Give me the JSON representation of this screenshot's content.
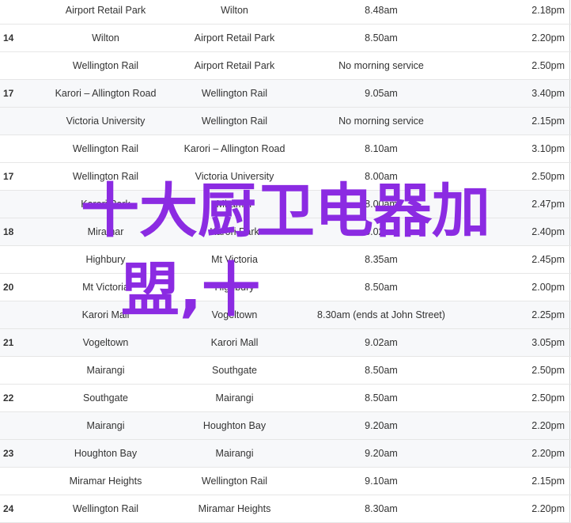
{
  "rows": [
    {
      "route": "",
      "from": "Airport Retail Park",
      "to": "Wilton",
      "depart": "8.48am",
      "arrive": "2.18pm",
      "shade": false
    },
    {
      "route": "14",
      "from": "Wilton",
      "to": "Airport Retail Park",
      "depart": "8.50am",
      "arrive": "2.20pm",
      "shade": false
    },
    {
      "route": "",
      "from": "Wellington Rail",
      "to": "Airport Retail Park",
      "depart": "No morning service",
      "arrive": "2.50pm",
      "shade": false
    },
    {
      "route": "17",
      "from": "Karori – Allington Road",
      "to": "Wellington Rail",
      "depart": "9.05am",
      "arrive": "3.40pm",
      "shade": true
    },
    {
      "route": "",
      "from": "Victoria University",
      "to": "Wellington Rail",
      "depart": "No morning service",
      "arrive": "2.15pm",
      "shade": true
    },
    {
      "route": "",
      "from": "Wellington Rail",
      "to": "Karori – Allington Road",
      "depart": "8.10am",
      "arrive": "3.10pm",
      "shade": false
    },
    {
      "route": "17",
      "from": "Wellington Rail",
      "to": "Victoria University",
      "depart": "8.00am",
      "arrive": "2.50pm",
      "shade": false
    },
    {
      "route": "",
      "from": "Karori Park",
      "to": "Miramar",
      "depart": "8.00am",
      "arrive": "2.47pm",
      "shade": true
    },
    {
      "route": "18",
      "from": "Miramar",
      "to": "Karori Park",
      "depart": "8.02am",
      "arrive": "2.40pm",
      "shade": true
    },
    {
      "route": "",
      "from": "Highbury",
      "to": "Mt Victoria",
      "depart": "8.35am",
      "arrive": "2.45pm",
      "shade": false
    },
    {
      "route": "20",
      "from": "Mt Victoria",
      "to": "Highbury",
      "depart": "8.50am",
      "arrive": "2.00pm",
      "shade": false
    },
    {
      "route": "",
      "from": "Karori Mall",
      "to": "Vogeltown",
      "depart": "8.30am (ends at John Street)",
      "arrive": "2.25pm",
      "shade": true
    },
    {
      "route": "21",
      "from": "Vogeltown",
      "to": "Karori Mall",
      "depart": "9.02am",
      "arrive": "3.05pm",
      "shade": true
    },
    {
      "route": "",
      "from": "Mairangi",
      "to": "Southgate",
      "depart": "8.50am",
      "arrive": "2.50pm",
      "shade": false
    },
    {
      "route": "22",
      "from": "Southgate",
      "to": "Mairangi",
      "depart": "8.50am",
      "arrive": "2.50pm",
      "shade": false
    },
    {
      "route": "",
      "from": "Mairangi",
      "to": "Houghton Bay",
      "depart": "9.20am",
      "arrive": "2.20pm",
      "shade": true
    },
    {
      "route": "23",
      "from": "Houghton Bay",
      "to": "Mairangi",
      "depart": "9.20am",
      "arrive": "2.20pm",
      "shade": true
    },
    {
      "route": "",
      "from": "Miramar Heights",
      "to": "Wellington Rail",
      "depart": "9.10am",
      "arrive": "2.15pm",
      "shade": false
    },
    {
      "route": "24",
      "from": "Wellington Rail",
      "to": "Miramar Heights",
      "depart": "8.30am",
      "arrive": "2.20pm",
      "shade": false
    }
  ],
  "overlay": {
    "line1": "十大厨卫电器加",
    "line2": "盟,十",
    "color": "#8b2be2"
  }
}
